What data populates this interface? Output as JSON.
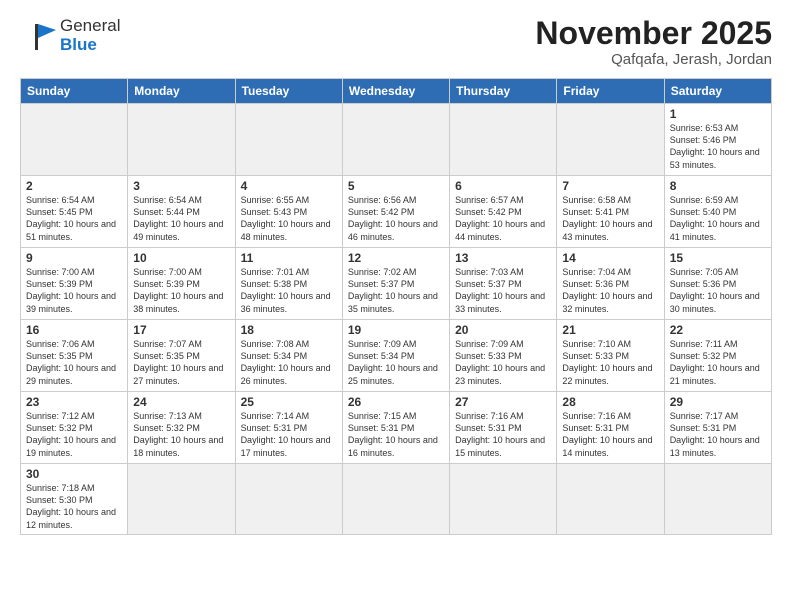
{
  "logo": {
    "general": "General",
    "blue": "Blue"
  },
  "title": "November 2025",
  "subtitle": "Qafqafa, Jerash, Jordan",
  "weekdays": [
    "Sunday",
    "Monday",
    "Tuesday",
    "Wednesday",
    "Thursday",
    "Friday",
    "Saturday"
  ],
  "weeks": [
    [
      {
        "day": "",
        "info": ""
      },
      {
        "day": "",
        "info": ""
      },
      {
        "day": "",
        "info": ""
      },
      {
        "day": "",
        "info": ""
      },
      {
        "day": "",
        "info": ""
      },
      {
        "day": "",
        "info": ""
      },
      {
        "day": "1",
        "info": "Sunrise: 6:53 AM\nSunset: 5:46 PM\nDaylight: 10 hours and 53 minutes."
      }
    ],
    [
      {
        "day": "2",
        "info": "Sunrise: 6:54 AM\nSunset: 5:45 PM\nDaylight: 10 hours and 51 minutes."
      },
      {
        "day": "3",
        "info": "Sunrise: 6:54 AM\nSunset: 5:44 PM\nDaylight: 10 hours and 49 minutes."
      },
      {
        "day": "4",
        "info": "Sunrise: 6:55 AM\nSunset: 5:43 PM\nDaylight: 10 hours and 48 minutes."
      },
      {
        "day": "5",
        "info": "Sunrise: 6:56 AM\nSunset: 5:42 PM\nDaylight: 10 hours and 46 minutes."
      },
      {
        "day": "6",
        "info": "Sunrise: 6:57 AM\nSunset: 5:42 PM\nDaylight: 10 hours and 44 minutes."
      },
      {
        "day": "7",
        "info": "Sunrise: 6:58 AM\nSunset: 5:41 PM\nDaylight: 10 hours and 43 minutes."
      },
      {
        "day": "8",
        "info": "Sunrise: 6:59 AM\nSunset: 5:40 PM\nDaylight: 10 hours and 41 minutes."
      }
    ],
    [
      {
        "day": "9",
        "info": "Sunrise: 7:00 AM\nSunset: 5:39 PM\nDaylight: 10 hours and 39 minutes."
      },
      {
        "day": "10",
        "info": "Sunrise: 7:00 AM\nSunset: 5:39 PM\nDaylight: 10 hours and 38 minutes."
      },
      {
        "day": "11",
        "info": "Sunrise: 7:01 AM\nSunset: 5:38 PM\nDaylight: 10 hours and 36 minutes."
      },
      {
        "day": "12",
        "info": "Sunrise: 7:02 AM\nSunset: 5:37 PM\nDaylight: 10 hours and 35 minutes."
      },
      {
        "day": "13",
        "info": "Sunrise: 7:03 AM\nSunset: 5:37 PM\nDaylight: 10 hours and 33 minutes."
      },
      {
        "day": "14",
        "info": "Sunrise: 7:04 AM\nSunset: 5:36 PM\nDaylight: 10 hours and 32 minutes."
      },
      {
        "day": "15",
        "info": "Sunrise: 7:05 AM\nSunset: 5:36 PM\nDaylight: 10 hours and 30 minutes."
      }
    ],
    [
      {
        "day": "16",
        "info": "Sunrise: 7:06 AM\nSunset: 5:35 PM\nDaylight: 10 hours and 29 minutes."
      },
      {
        "day": "17",
        "info": "Sunrise: 7:07 AM\nSunset: 5:35 PM\nDaylight: 10 hours and 27 minutes."
      },
      {
        "day": "18",
        "info": "Sunrise: 7:08 AM\nSunset: 5:34 PM\nDaylight: 10 hours and 26 minutes."
      },
      {
        "day": "19",
        "info": "Sunrise: 7:09 AM\nSunset: 5:34 PM\nDaylight: 10 hours and 25 minutes."
      },
      {
        "day": "20",
        "info": "Sunrise: 7:09 AM\nSunset: 5:33 PM\nDaylight: 10 hours and 23 minutes."
      },
      {
        "day": "21",
        "info": "Sunrise: 7:10 AM\nSunset: 5:33 PM\nDaylight: 10 hours and 22 minutes."
      },
      {
        "day": "22",
        "info": "Sunrise: 7:11 AM\nSunset: 5:32 PM\nDaylight: 10 hours and 21 minutes."
      }
    ],
    [
      {
        "day": "23",
        "info": "Sunrise: 7:12 AM\nSunset: 5:32 PM\nDaylight: 10 hours and 19 minutes."
      },
      {
        "day": "24",
        "info": "Sunrise: 7:13 AM\nSunset: 5:32 PM\nDaylight: 10 hours and 18 minutes."
      },
      {
        "day": "25",
        "info": "Sunrise: 7:14 AM\nSunset: 5:31 PM\nDaylight: 10 hours and 17 minutes."
      },
      {
        "day": "26",
        "info": "Sunrise: 7:15 AM\nSunset: 5:31 PM\nDaylight: 10 hours and 16 minutes."
      },
      {
        "day": "27",
        "info": "Sunrise: 7:16 AM\nSunset: 5:31 PM\nDaylight: 10 hours and 15 minutes."
      },
      {
        "day": "28",
        "info": "Sunrise: 7:16 AM\nSunset: 5:31 PM\nDaylight: 10 hours and 14 minutes."
      },
      {
        "day": "29",
        "info": "Sunrise: 7:17 AM\nSunset: 5:31 PM\nDaylight: 10 hours and 13 minutes."
      }
    ],
    [
      {
        "day": "30",
        "info": "Sunrise: 7:18 AM\nSunset: 5:30 PM\nDaylight: 10 hours and 12 minutes."
      },
      {
        "day": "",
        "info": ""
      },
      {
        "day": "",
        "info": ""
      },
      {
        "day": "",
        "info": ""
      },
      {
        "day": "",
        "info": ""
      },
      {
        "day": "",
        "info": ""
      },
      {
        "day": "",
        "info": ""
      }
    ]
  ]
}
